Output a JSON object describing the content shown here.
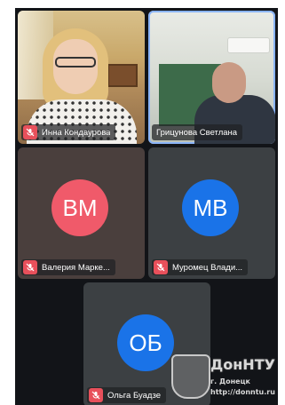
{
  "participants": [
    {
      "name": "Инна Кондаурова",
      "muted": true,
      "type": "video"
    },
    {
      "name": "Грицунова Светлана",
      "muted": false,
      "type": "video",
      "active": true
    },
    {
      "name": "Валерия Марке...",
      "muted": true,
      "type": "avatar",
      "initials": "ВМ",
      "avatar_color": "#f05a6a"
    },
    {
      "name": "Муромец Влади...",
      "muted": true,
      "type": "avatar",
      "initials": "МВ",
      "avatar_color": "#1a73e8"
    },
    {
      "name": "Ольга Буадзе",
      "muted": true,
      "type": "avatar",
      "initials": "ОБ",
      "avatar_color": "#1a73e8"
    }
  ],
  "watermark": {
    "title": "ДонНТУ",
    "city": "г. Донецк",
    "url": "http://donntu.ru"
  },
  "colors": {
    "mic_off": "#e8505b",
    "active_border": "#8ab4f8",
    "background": "#121418"
  }
}
